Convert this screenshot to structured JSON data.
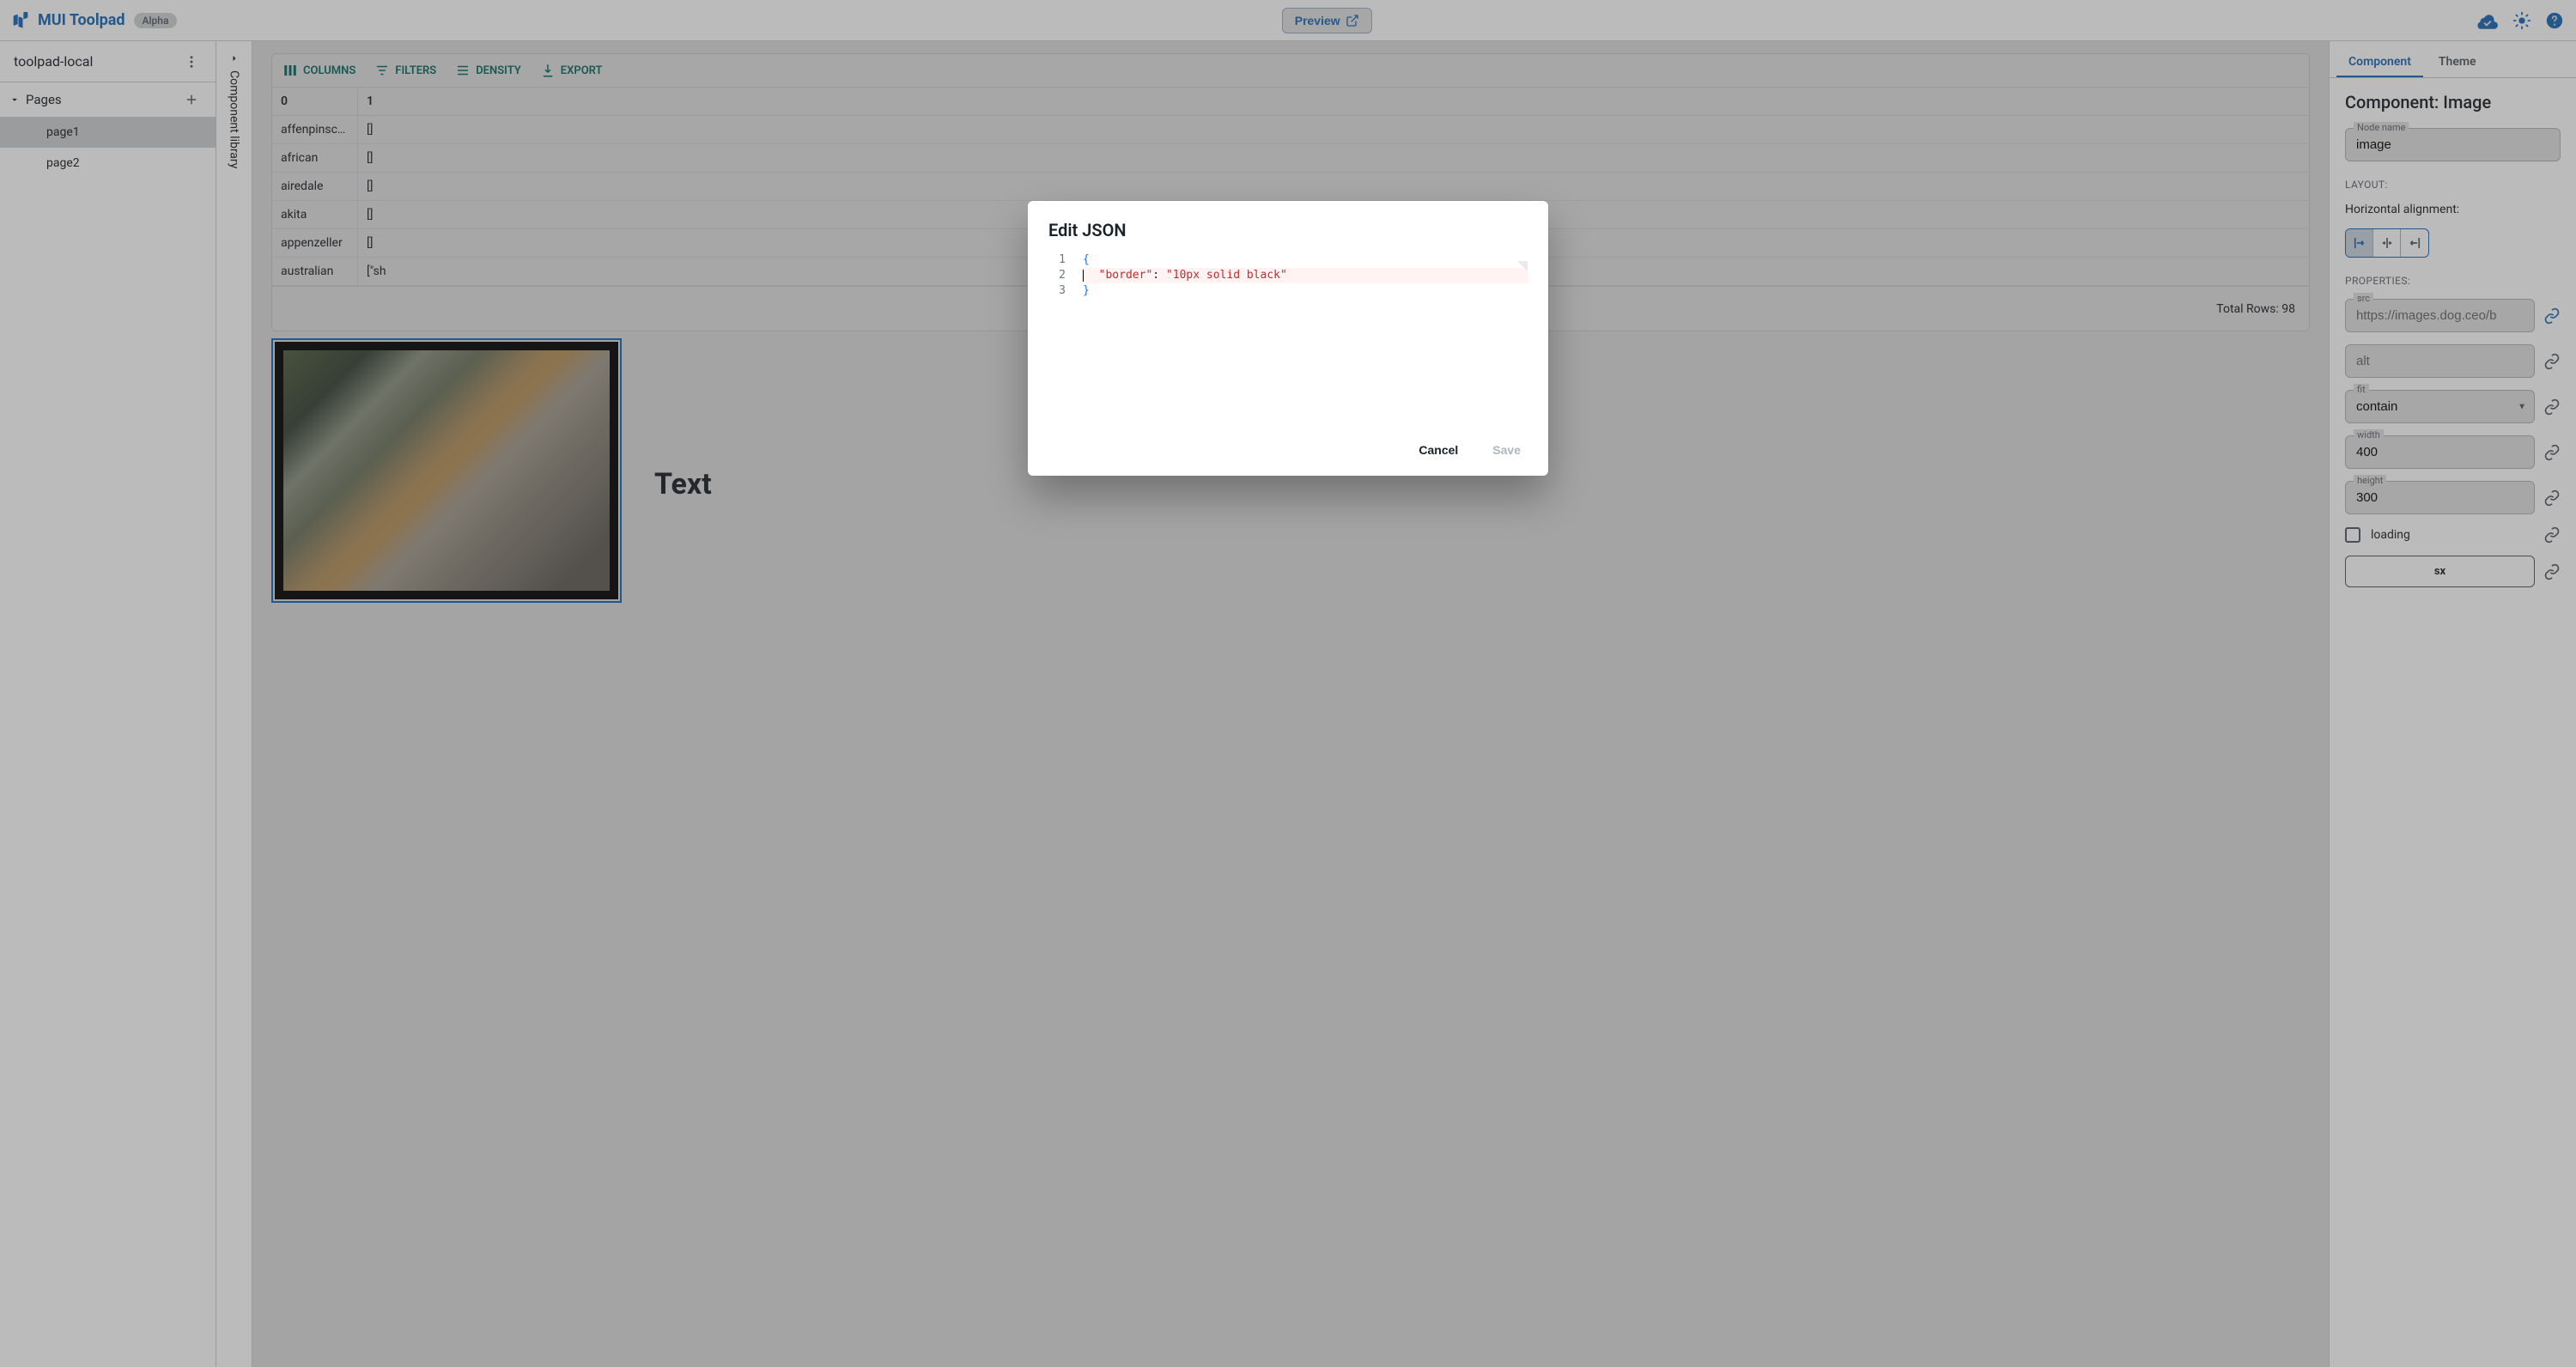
{
  "header": {
    "app_name": "MUI Toolpad",
    "badge": "Alpha",
    "preview": "Preview"
  },
  "sidebar": {
    "project": "toolpad-local",
    "pages_label": "Pages",
    "pages": [
      {
        "label": "page1",
        "selected": true
      },
      {
        "label": "page2",
        "selected": false
      }
    ]
  },
  "rail": {
    "label": "Component library"
  },
  "datagrid": {
    "tools": {
      "columns": "COLUMNS",
      "filters": "FILTERS",
      "density": "DENSITY",
      "export": "EXPORT"
    },
    "headers": [
      "0",
      "1"
    ],
    "rows": [
      {
        "c0": "affenpinsc…",
        "c1": "[]"
      },
      {
        "c0": "african",
        "c1": "[]"
      },
      {
        "c0": "airedale",
        "c1": "[]"
      },
      {
        "c0": "akita",
        "c1": "[]"
      },
      {
        "c0": "appenzeller",
        "c1": "[]"
      },
      {
        "c0": "australian",
        "c1": "[\"sh"
      }
    ],
    "footer": "Total Rows: 98"
  },
  "canvas": {
    "text_component": "Text"
  },
  "inspector": {
    "tabs": {
      "component": "Component",
      "theme": "Theme"
    },
    "title": "Component: Image",
    "node_name": {
      "label": "Node name",
      "value": "image"
    },
    "layout_label": "LAYOUT:",
    "halign_label": "Horizontal alignment:",
    "props_label": "PROPERTIES:",
    "src": {
      "label": "src",
      "placeholder": "https://images.dog.ceo/b"
    },
    "alt": {
      "placeholder": "alt"
    },
    "fit": {
      "label": "fit",
      "value": "contain"
    },
    "width": {
      "label": "width",
      "value": "400"
    },
    "height": {
      "label": "height",
      "value": "300"
    },
    "loading": "loading",
    "sx": "sx"
  },
  "modal": {
    "title": "Edit JSON",
    "code_lines": {
      "l1": "{",
      "l2_key": "\"border\"",
      "l2_sep": ": ",
      "l2_val": "\"10px solid black\"",
      "l3": "}"
    },
    "cancel": "Cancel",
    "save": "Save"
  }
}
